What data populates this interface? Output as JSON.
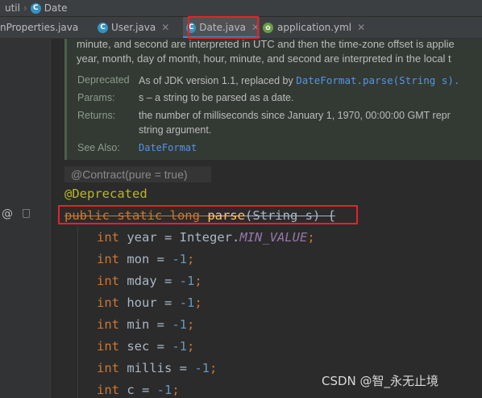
{
  "breadcrumb": {
    "items": [
      "util",
      "Date"
    ],
    "class_icon": "C"
  },
  "tabs": [
    {
      "label": "nProperties.java",
      "active": false,
      "icon": "none"
    },
    {
      "label": "User.java",
      "active": false,
      "icon": "class-icon"
    },
    {
      "label": "Date.java",
      "active": true,
      "icon": "class-icon"
    },
    {
      "label": "application.yml",
      "active": false,
      "icon": "spring-leaf-icon"
    }
  ],
  "doc": {
    "line1": "minute, and second are interpreted in UTC and then the time-zone offset is applie",
    "line2": "year, month, day of month, hour, minute, and second are interpreted in the local t",
    "deprecated_label": "Deprecated",
    "deprecated_text": "As of JDK version 1.1, replaced by ",
    "deprecated_code": "DateFormat.parse(String s).",
    "params_label": "Params:",
    "params_text": "s – a string to be parsed as a date.",
    "returns_label": "Returns:",
    "returns_line1": "the number of milliseconds since January 1, 1970, 00:00:00 GMT repr",
    "returns_line2": "string argument.",
    "seealso_label": "See Also:",
    "seealso_link": "DateFormat"
  },
  "contract": "@Contract(pure = true)",
  "code": {
    "annotation": "@Deprecated",
    "sig_kw": "public static long ",
    "sig_name": "parse",
    "sig_rest": "(String s) {",
    "lines": [
      {
        "type": "int",
        "name": " year = ",
        "value": "Integer.",
        "value_const": "MIN_VALUE",
        "end": ";"
      },
      {
        "type": "int",
        "name": " mon = ",
        "value": "-1",
        "end": ";"
      },
      {
        "type": "int",
        "name": " mday = ",
        "value": "-1",
        "end": ";"
      },
      {
        "type": "int",
        "name": " hour = ",
        "value": "-1",
        "end": ";"
      },
      {
        "type": "int",
        "name": " min = ",
        "value": "-1",
        "end": ";"
      },
      {
        "type": "int",
        "name": " sec = ",
        "value": "-1",
        "end": ";"
      },
      {
        "type": "int",
        "name": " millis = ",
        "value": "-1",
        "end": ";"
      },
      {
        "type": "int",
        "name": " c = ",
        "value": "-1",
        "end": ";"
      }
    ]
  },
  "gutter": {
    "at_marker": "@"
  },
  "watermark": "CSDN @智_永无止境",
  "colors": {
    "highlight": "#e8202a",
    "keyword": "#cc7832",
    "annotation": "#bbb529",
    "number": "#6897bb",
    "constant": "#9876aa",
    "function": "#ffc66d"
  }
}
